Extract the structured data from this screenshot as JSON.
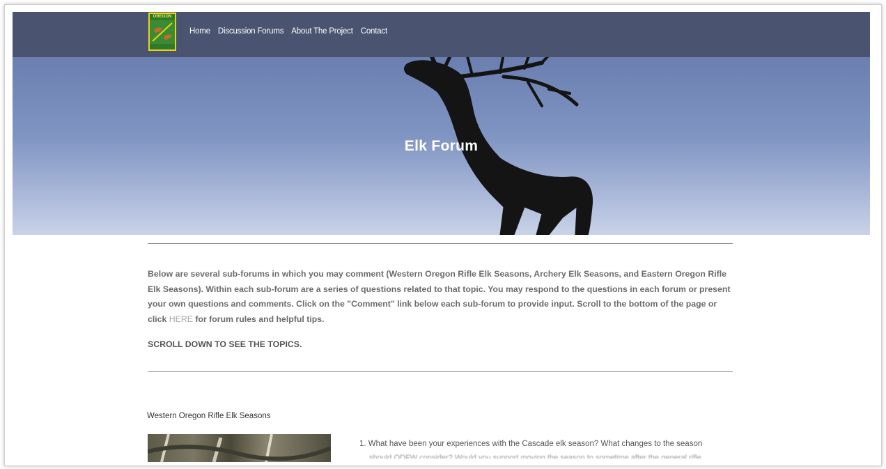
{
  "nav": {
    "logo_text": "OREGON",
    "logo_subtext": "Fish & Wildlife",
    "links": [
      "Home",
      "Discussion Forums",
      "About The Project",
      "Contact"
    ]
  },
  "hero": {
    "title": "Elk Forum"
  },
  "intro": {
    "text_before_link": "Below are several sub-forums in which you may comment (Western Oregon Rifle Elk Seasons, Archery Elk Seasons, and Eastern Oregon Rifle Elk Seasons). Within each sub-forum are a series of questions related to that topic. You may respond to the questions in each forum or present your own questions and comments. Click on the \"Comment\" link below each sub-forum to provide input. Scroll to the bottom of the page or click ",
    "link_text": "HERE",
    "text_after_link": " for forum rules and helpful tips.",
    "scroll_note": "SCROLL DOWN TO SEE THE TOPICS."
  },
  "subforum": {
    "title": "Western Oregon Rifle Elk Seasons",
    "question_1": "1. What have been your experiences with the Cascade elk season? What changes to the season",
    "question_1_cont": "should ODFW consider? Would you support moving the season to sometime after the general rifle"
  },
  "colors": {
    "navbar_bg": "#4a5470",
    "hero_sky_top": "#6a7fb0",
    "hero_sky_bottom": "#c9d3e8",
    "elk_silhouette": "#141414",
    "intro_text": "#6b6b6b",
    "link_text": "#a6a6a6"
  }
}
